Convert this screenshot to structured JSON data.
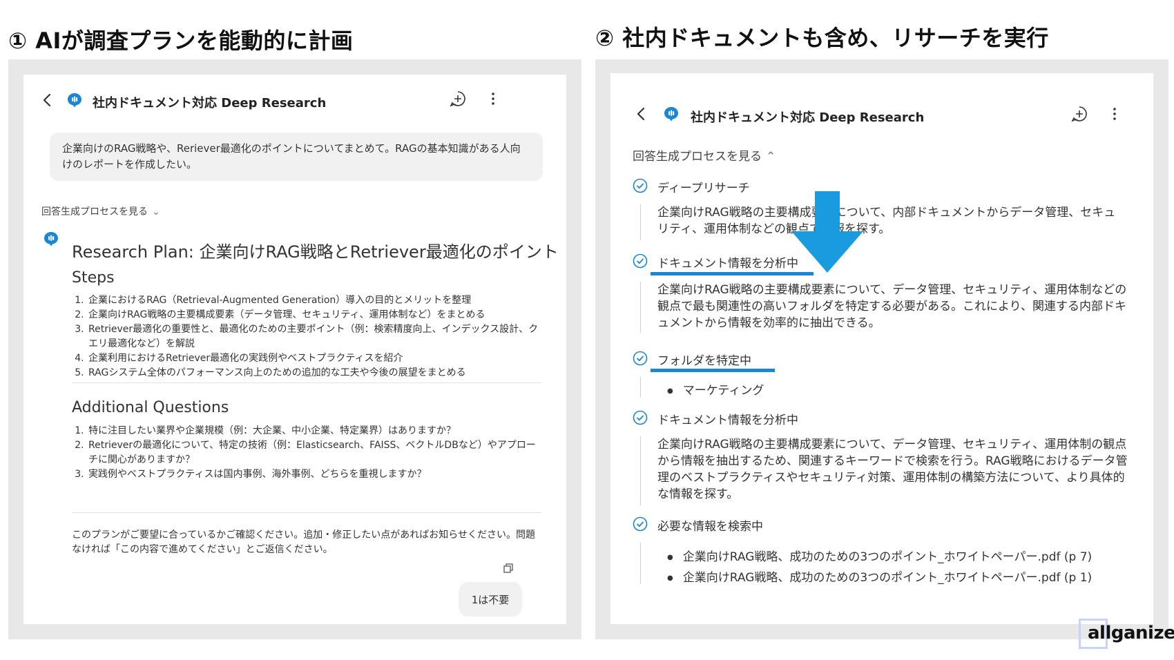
{
  "headings": {
    "left": "① AIが調査プランを能動的に計画",
    "right": "② 社内ドキュメントも含め、リサーチを実行"
  },
  "left": {
    "app_title": "社内ドキュメント対応 Deep Research",
    "user_message": "企業向けのRAG戦略や、Reriever最適化のポイントについてまとめて。RAGの基本知識がある人向けのレポートを作成したい。",
    "process_toggle": "回答生成プロセスを見る",
    "plan_title": "Research Plan: 企業向けRAG戦略とRetriever最適化のポイント",
    "steps_title": "Steps",
    "steps": [
      "企業におけるRAG（Retrieval-Augmented Generation）導入の目的とメリットを整理",
      "企業向けRAG戦略の主要構成要素（データ管理、セキュリティ、運用体制など）をまとめる",
      "Retriever最適化の重要性と、最適化のための主要ポイント（例：検索精度向上、インデックス設計、クエリ最適化など）を解説",
      "企業利用におけるRetriever最適化の実践例やベストプラクティスを紹介",
      "RAGシステム全体のパフォーマンス向上のための追加的な工夫や今後の展望をまとめる"
    ],
    "questions_title": "Additional Questions",
    "questions": [
      "特に注目したい業界や企業規模（例：大企業、中小企業、特定業界）はありますか？",
      "Retrieverの最適化について、特定の技術（例：Elasticsearch、FAISS、ベクトルDBなど）やアプローチに関心がありますか？",
      "実践例やベストプラクティスは国内事例、海外事例、どちらを重視しますか？"
    ],
    "confirm_text": "このプランがご要望に合っているかご確認ください。追加・修正したい点があればお知らせください。問題なければ「この内容で進めてください」とご返信ください。",
    "reply": "1は不要"
  },
  "right": {
    "app_title": "社内ドキュメント対応 Deep Research",
    "process_toggle": "回答生成プロセスを見る",
    "steps": [
      {
        "label": "ディープリサーチ",
        "body": "企業向けRAG戦略の主要構成要素について、内部ドキュメントからデータ管理、セキュリティ、運用体制などの観点で情報を探す。"
      },
      {
        "label": "ドキュメント情報を分析中",
        "body": "企業向けRAG戦略の主要構成要素について、データ管理、セキュリティ、運用体制などの観点で最も関連性の高いフォルダを特定する必要がある。これにより、関連する内部ドキュメントから情報を効率的に抽出できる。"
      },
      {
        "label": "フォルダを特定中",
        "bullet": "マーケティング"
      },
      {
        "label": "ドキュメント情報を分析中",
        "body": "企業向けRAG戦略の主要構成要素について、データ管理、セキュリティ、運用体制の観点から情報を抽出するため、関連するキーワードで検索を行う。RAG戦略におけるデータ管理のベストプラクティスやセキュリティ対策、運用体制の構築方法について、より具体的な情報を探す。"
      },
      {
        "label": "必要な情報を検索中",
        "bullets": [
          "企業向けRAG戦略、成功のための3つのポイント_ホワイトペーパー.pdf (p 7)",
          "企業向けRAG戦略、成功のための3つのポイント_ホワイトペーパー.pdf (p 1)"
        ]
      }
    ]
  },
  "logo": "allganize",
  "colors": {
    "accent": "#1a86d6",
    "arrow": "#1a9be0",
    "logo_box": "#c7d2ff"
  }
}
